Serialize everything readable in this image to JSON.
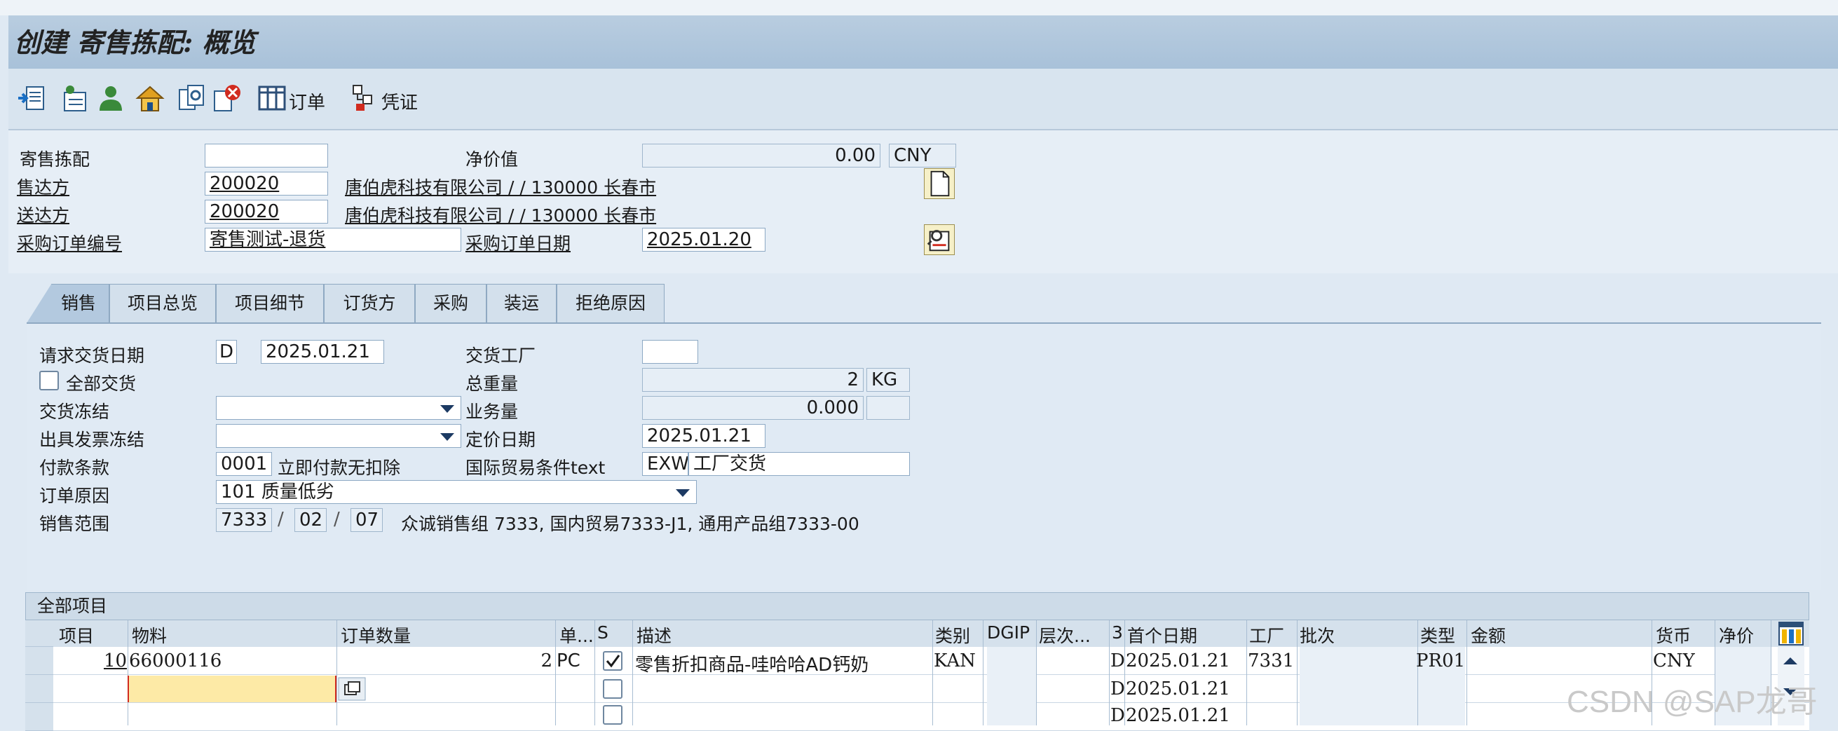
{
  "title": "创建 寄售拣配: 概览",
  "toolbar": {
    "order_label": "订单",
    "voucher_label": "凭证"
  },
  "header": {
    "consign_pick_label": "寄售拣配",
    "consign_pick_value": "",
    "net_value_label": "净价值",
    "net_value": "0.00",
    "currency": "CNY",
    "sold_to_label": "售达方",
    "sold_to_value": "200020",
    "sold_to_desc": "唐伯虎科技有限公司 / / 130000 长春市",
    "ship_to_label": "送达方",
    "ship_to_value": "200020",
    "ship_to_desc": "唐伯虎科技有限公司 / / 130000 长春市",
    "po_number_label": "采购订单编号",
    "po_number_value": "寄售测试-退货",
    "po_date_label": "采购订单日期",
    "po_date_value": "2025.01.20"
  },
  "tabs": [
    "销售",
    "项目总览",
    "项目细节",
    "订货方",
    "采购",
    "装运",
    "拒绝原因"
  ],
  "sales": {
    "req_delivery_date_label": "请求交货日期",
    "req_delivery_date_type": "D",
    "req_delivery_date": "2025.01.21",
    "delivery_plant_label": "交货工厂",
    "delivery_plant_value": "",
    "complete_delivery_label": "全部交货",
    "total_weight_label": "总重量",
    "total_weight": "2",
    "weight_unit": "KG",
    "delivery_block_label": "交货冻结",
    "volume_label": "业务量",
    "volume": "0.000",
    "billing_block_label": "出具发票冻结",
    "pricing_date_label": "定价日期",
    "pricing_date": "2025.01.21",
    "payment_terms_label": "付款条款",
    "payment_terms_code": "0001",
    "payment_terms_desc": "立即付款无扣除",
    "incoterms_label": "国际贸易条件text",
    "incoterms_code": "EXW",
    "incoterms_desc": "工厂交货",
    "order_reason_label": "订单原因",
    "order_reason_value": "101 质量低劣",
    "sales_area_label": "销售范围",
    "sales_org": "7333",
    "dist_channel": "02",
    "division": "07",
    "sales_area_desc": "众诚销售组 7333, 国内贸易7333-J1, 通用产品组7333-00"
  },
  "grid": {
    "title": "全部项目",
    "headers": {
      "item": "项目",
      "material": "物料",
      "qty": "订单数量",
      "unit": "单...",
      "s": "S",
      "desc": "描述",
      "category": "类别",
      "dgip": "DGIP",
      "level": "层次...",
      "d": "3",
      "first_date": "首个日期",
      "plant": "工厂",
      "batch": "批次",
      "type": "类型",
      "amount": "金额",
      "currency": "货币",
      "net_price": "净价"
    },
    "rows": [
      {
        "item": "10",
        "material": "66000116",
        "qty": "2",
        "unit": "PC",
        "desc": "零售折扣商品-哇哈哈AD钙奶",
        "category": "KAN",
        "d": "D",
        "first_date": "2025.01.21",
        "plant": "7331",
        "type": "PR01",
        "currency": "CNY"
      },
      {
        "d": "D",
        "first_date": "2025.01.21"
      },
      {
        "d": "D",
        "first_date": "2025.01.21"
      }
    ]
  },
  "watermark": "CSDN @SAP龙哥"
}
